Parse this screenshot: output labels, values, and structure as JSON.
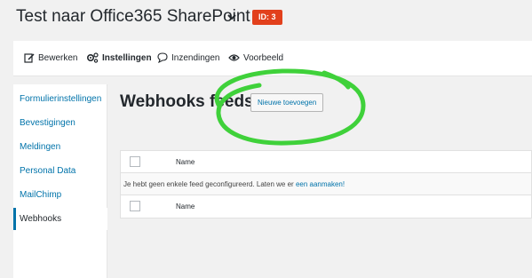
{
  "header": {
    "form_title": "Test naar Office365 SharePoint",
    "id_badge": "ID: 3"
  },
  "toolbar": {
    "items": [
      {
        "label": "Bewerken",
        "icon": "edit-icon"
      },
      {
        "label": "Instellingen",
        "icon": "gears-icon",
        "active": true
      },
      {
        "label": "Inzendingen",
        "icon": "comment-icon"
      },
      {
        "label": "Voorbeeld",
        "icon": "eye-icon"
      }
    ]
  },
  "sidebar": {
    "items": [
      {
        "label": "Formulierinstellingen"
      },
      {
        "label": "Bevestigingen"
      },
      {
        "label": "Meldingen"
      },
      {
        "label": "Personal Data"
      },
      {
        "label": "MailChimp"
      },
      {
        "label": "Webhooks",
        "active": true
      }
    ]
  },
  "main": {
    "heading": "Webhooks feeds",
    "add_button": "Nieuwe toevoegen",
    "table": {
      "column_name": "Name",
      "empty_text": "Je hebt geen enkele feed geconfigureerd. Laten we er",
      "empty_link": "een aanmaken!"
    }
  },
  "colors": {
    "accent": "#0073aa",
    "badge": "#e2401c",
    "annotation": "#3fd13a"
  }
}
